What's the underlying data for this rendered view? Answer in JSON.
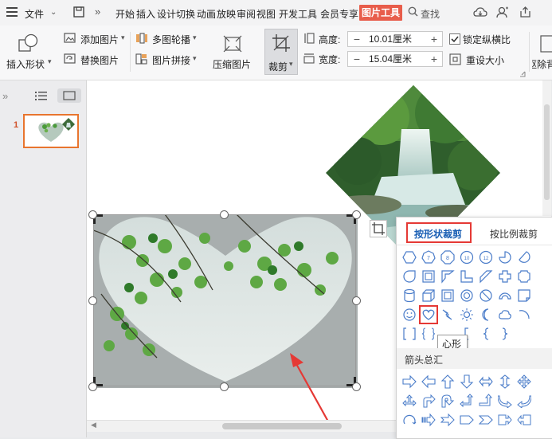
{
  "menu": {
    "file_label": "文件",
    "tabs": [
      "开始",
      "插入",
      "设计",
      "切换",
      "动画",
      "放映",
      "审阅",
      "视图",
      "开发工具",
      "会员专享"
    ],
    "active_tab": "图片工具",
    "search_label": "查找"
  },
  "ribbon": {
    "insert_shape": "插入形状",
    "add_picture": "添加图片",
    "replace_picture": "替换图片",
    "multi_carousel": "多图轮播",
    "picture_mosaic": "图片拼接",
    "compress_picture": "压缩图片",
    "crop": "裁剪",
    "height_label": "高度:",
    "height_value": "10.01厘米",
    "width_label": "宽度:",
    "width_value": "15.04厘米",
    "lock_ratio": "锁定纵横比",
    "lock_ratio_checked": true,
    "reset_size": "重设大小",
    "remove_bg": "抠除背"
  },
  "thumbnails": [
    {
      "number": "1"
    }
  ],
  "crop_popup": {
    "tab_by_shape": "按形状裁剪",
    "tab_by_ratio": "按比例裁剪",
    "tooltip": "心形",
    "section_arrows": "箭头总汇"
  },
  "colors": {
    "accent": "#e85d4b",
    "highlight_box": "#e53935",
    "selected_tab_text": "#1a5fb4",
    "shape_icon": "#4a7cc9",
    "arrow": "#e53935"
  }
}
